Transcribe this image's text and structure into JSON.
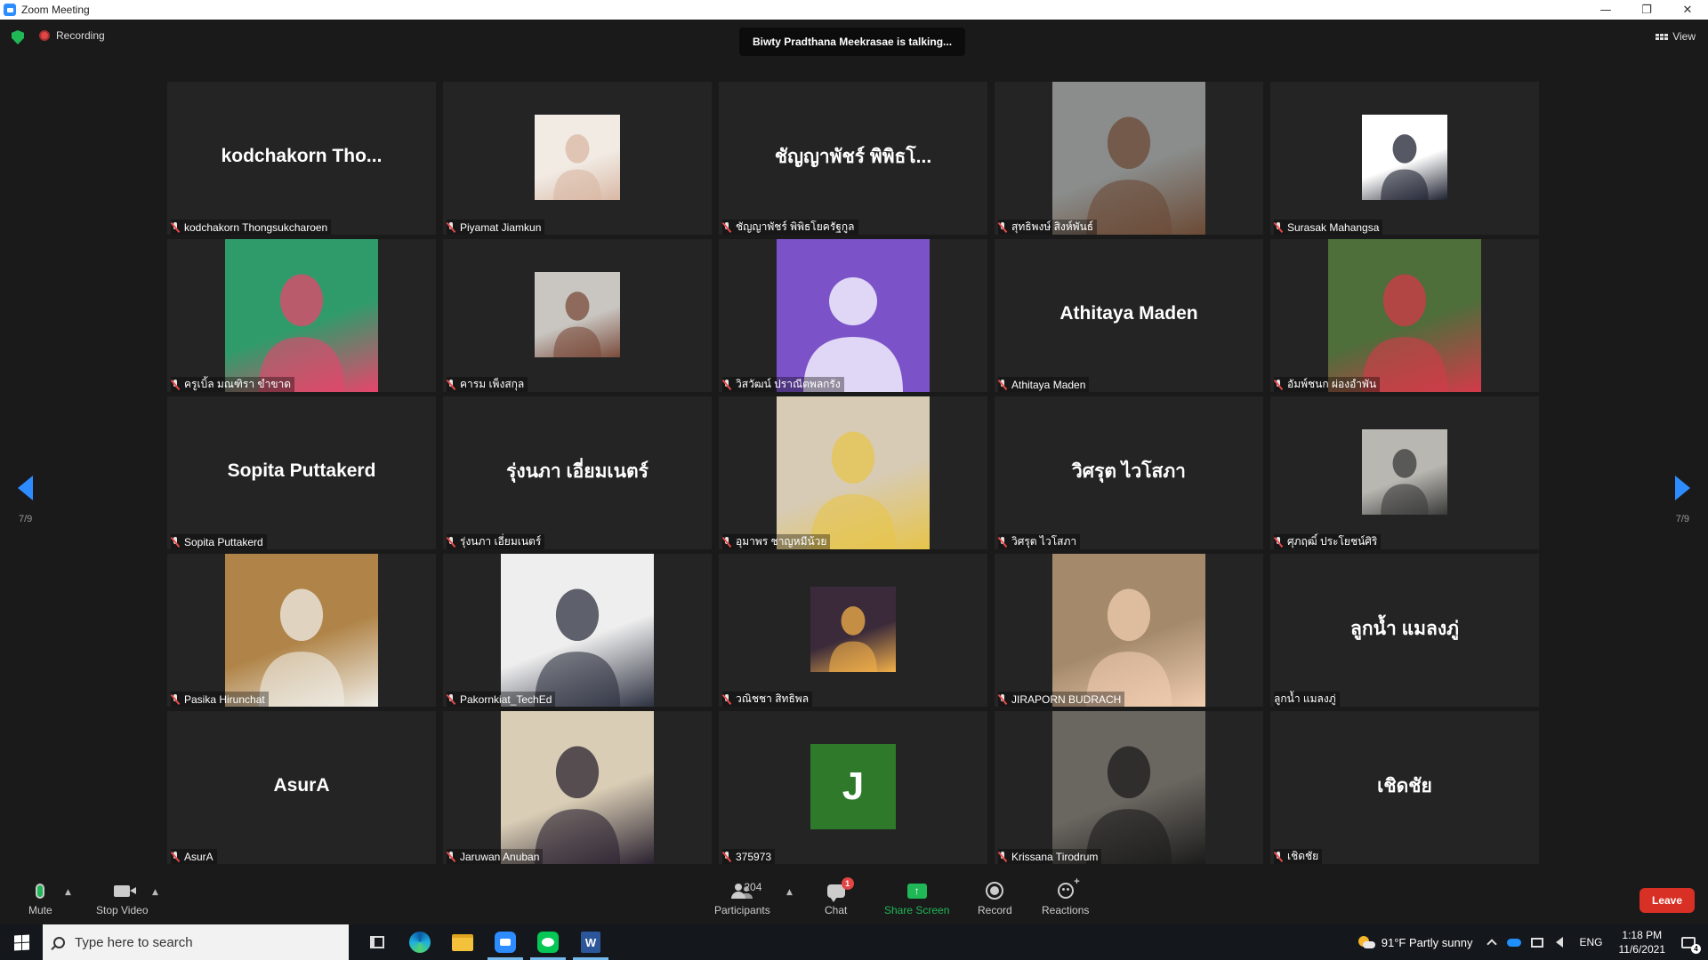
{
  "window": {
    "title": "Zoom Meeting"
  },
  "topbar": {
    "recording": "Recording",
    "talking": "Biwty Pradthana Meekrasae is talking...",
    "view": "View"
  },
  "pager": {
    "current": "7/9"
  },
  "participants": [
    {
      "label": "kodchakorn Thongsukcharoen",
      "big": "kodchakorn  Tho...",
      "kind": "name"
    },
    {
      "label": "Piyamat Jiamkun",
      "big": "",
      "kind": "photo-small",
      "bg": "#f1ebe4",
      "fg": "#d9b8a4"
    },
    {
      "label": "ชัญญาพัชร์ พิพิธโยครัฐกูล",
      "big": "ชัญญาพัชร์ พิพิธโ...",
      "kind": "name"
    },
    {
      "label": "สุทธิพงษ์ สิงห์พันธ์",
      "big": "",
      "kind": "photo",
      "bg": "#8a8d8c",
      "fg": "#6b4a35"
    },
    {
      "label": "Surasak Mahangsa",
      "big": "",
      "kind": "photo-small",
      "bg": "#ffffff",
      "fg": "#1e2230"
    },
    {
      "label": "ครูเบิ้ล มณฑิรา ขำขาด",
      "big": "",
      "kind": "photo",
      "bg": "#2f9b6b",
      "fg": "#e8456b"
    },
    {
      "label": "คารม เพ็งสกุล",
      "big": "",
      "kind": "photo-small",
      "bg": "#c9c6c1",
      "fg": "#7a4b3b"
    },
    {
      "label": "วิสวัฒน์ ปราณีตพลกรัง",
      "big": "",
      "kind": "avatar",
      "bg": "#7b52c8",
      "fg": "#e0d6f5"
    },
    {
      "label": "Athitaya Maden",
      "big": "Athitaya Maden",
      "kind": "name"
    },
    {
      "label": "อัมพ์ชนก ผ่องอำพัน",
      "big": "",
      "kind": "photo",
      "bg": "#4e6e3a",
      "fg": "#d43a4a"
    },
    {
      "label": "Sopita Puttakerd",
      "big": "Sopita Puttakerd",
      "kind": "name"
    },
    {
      "label": "รุ่งนภา เอี่ยมเนตร์",
      "big": "รุ่งนภา เอี่ยมเนตร์",
      "kind": "name"
    },
    {
      "label": "อุมาพร ชาญหมีน้วย",
      "big": "",
      "kind": "photo",
      "bg": "#d7cbb6",
      "fg": "#e7c44a"
    },
    {
      "label": "วิศรุต ไวโสภา",
      "big": "วิศรุต  ไวโสภา",
      "kind": "name"
    },
    {
      "label": "ศุภฤฒิ์ ประโยชน์ศิริ",
      "big": "",
      "kind": "photo-small",
      "bg": "#b9b7b1",
      "fg": "#3a3a3a"
    },
    {
      "label": "Pasika Hirunchat",
      "big": "",
      "kind": "photo",
      "bg": "#b08448",
      "fg": "#f0eee8"
    },
    {
      "label": "Pakornkiat_TechEd",
      "big": "",
      "kind": "photo",
      "bg": "#eeeeee",
      "fg": "#2d3140"
    },
    {
      "label": "วณิชชา สิทธิพล",
      "big": "",
      "kind": "photo-small",
      "bg": "#3a2a3a",
      "fg": "#f3b04a"
    },
    {
      "label": "JIRAPORN BUDRACH",
      "big": "",
      "kind": "photo",
      "bg": "#a48a6b",
      "fg": "#f1cdb0"
    },
    {
      "label": "ลูกน้ำ แมลงภู่",
      "big": "ลูกน้ำ  แมลงภู่",
      "kind": "name",
      "nomute": true
    },
    {
      "label": "AsurA",
      "big": "AsurA",
      "kind": "name"
    },
    {
      "label": "Jaruwan Anuban",
      "big": "",
      "kind": "photo",
      "bg": "#d9cdb5",
      "fg": "#2a2230"
    },
    {
      "label": "375973",
      "big": "J",
      "kind": "letter",
      "bg": "#2f7a2a",
      "fg": "#ffffff"
    },
    {
      "label": "Krissana  Tirodrum",
      "big": "",
      "kind": "photo",
      "bg": "#6a6660",
      "fg": "#1c1c1c"
    },
    {
      "label": "เชิดชัย",
      "big": "เชิดชัย",
      "kind": "name"
    }
  ],
  "toolbar": {
    "mute": "Mute",
    "stop_video": "Stop Video",
    "participants_label": "Participants",
    "participants_count": "204",
    "chat": "Chat",
    "chat_badge": "1",
    "share": "Share Screen",
    "record": "Record",
    "reactions": "Reactions",
    "leave": "Leave"
  },
  "taskbar": {
    "search_placeholder": "Type here to search",
    "weather": "91°F  Partly sunny",
    "lang": "ENG",
    "time": "1:18 PM",
    "date": "11/6/2021",
    "notif_count": "4"
  },
  "colors": {
    "accent": "#2d8cff",
    "share_green": "#20b757",
    "leave_red": "#d93025"
  }
}
